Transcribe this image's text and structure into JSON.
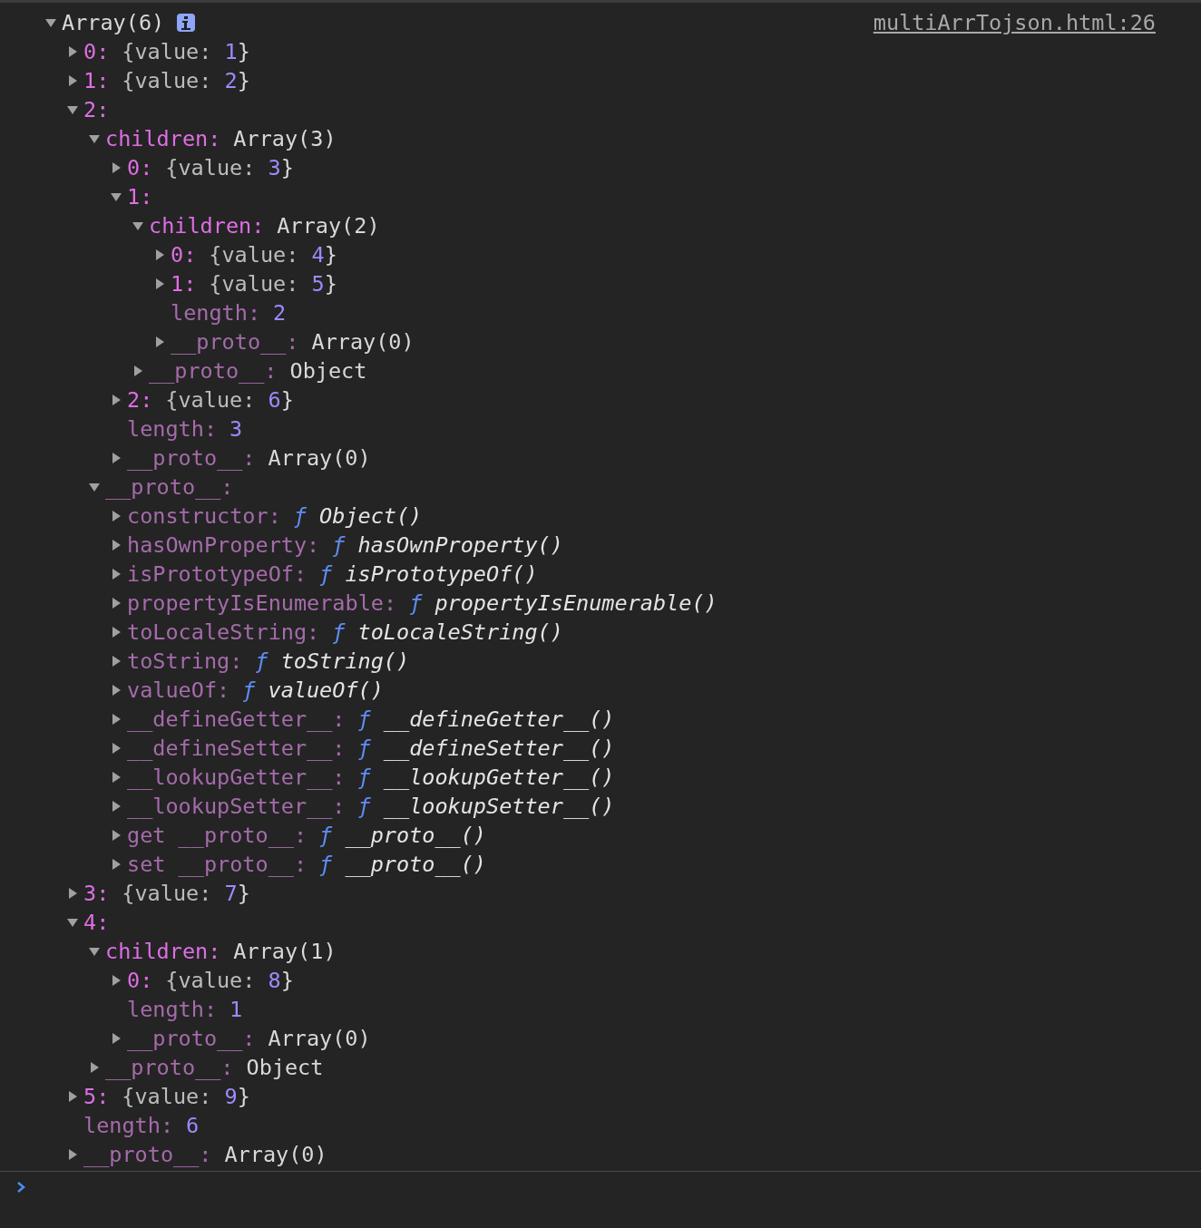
{
  "source": "multiArrTojson.html:26",
  "root": {
    "label": "Array(6)",
    "expanded": true,
    "children": [
      {
        "kind": "preview",
        "key": "0:",
        "own": true,
        "expanded": false,
        "preview": {
          "open": "{value:",
          "number": "1",
          "close": "}"
        }
      },
      {
        "kind": "preview",
        "key": "1:",
        "own": true,
        "expanded": false,
        "preview": {
          "open": "{value:",
          "number": "2",
          "close": "}"
        }
      },
      {
        "kind": "object",
        "key": "2:",
        "own": true,
        "expanded": true,
        "children": [
          {
            "kind": "object",
            "key": "children:",
            "own": true,
            "label": "Array(3)",
            "expanded": true,
            "children": [
              {
                "kind": "preview",
                "key": "0:",
                "own": true,
                "expanded": false,
                "preview": {
                  "open": "{value:",
                  "number": "3",
                  "close": "}"
                }
              },
              {
                "kind": "object",
                "key": "1:",
                "own": true,
                "expanded": true,
                "children": [
                  {
                    "kind": "object",
                    "key": "children:",
                    "own": true,
                    "label": "Array(2)",
                    "expanded": true,
                    "children": [
                      {
                        "kind": "preview",
                        "key": "0:",
                        "own": true,
                        "expanded": false,
                        "preview": {
                          "open": "{value:",
                          "number": "4",
                          "close": "}"
                        }
                      },
                      {
                        "kind": "preview",
                        "key": "1:",
                        "own": true,
                        "expanded": false,
                        "preview": {
                          "open": "{value:",
                          "number": "5",
                          "close": "}"
                        }
                      },
                      {
                        "kind": "number",
                        "key": "length:",
                        "own": false,
                        "value": "2"
                      },
                      {
                        "kind": "object",
                        "key": "__proto__:",
                        "own": false,
                        "label": "Array(0)",
                        "expanded": false
                      }
                    ]
                  },
                  {
                    "kind": "object",
                    "key": "__proto__:",
                    "own": false,
                    "label": "Object",
                    "expanded": false
                  }
                ]
              },
              {
                "kind": "preview",
                "key": "2:",
                "own": true,
                "expanded": false,
                "preview": {
                  "open": "{value:",
                  "number": "6",
                  "close": "}"
                }
              },
              {
                "kind": "number",
                "key": "length:",
                "own": false,
                "value": "3"
              },
              {
                "kind": "object",
                "key": "__proto__:",
                "own": false,
                "label": "Array(0)",
                "expanded": false
              }
            ]
          },
          {
            "kind": "object",
            "key": "__proto__:",
            "own": false,
            "expanded": true,
            "children": [
              {
                "kind": "function",
                "key": "constructor:",
                "own": false,
                "expanded": false,
                "mark": "ƒ",
                "name": "Object()"
              },
              {
                "kind": "function",
                "key": "hasOwnProperty:",
                "own": false,
                "expanded": false,
                "mark": "ƒ",
                "name": "hasOwnProperty()"
              },
              {
                "kind": "function",
                "key": "isPrototypeOf:",
                "own": false,
                "expanded": false,
                "mark": "ƒ",
                "name": "isPrototypeOf()"
              },
              {
                "kind": "function",
                "key": "propertyIsEnumerable:",
                "own": false,
                "expanded": false,
                "mark": "ƒ",
                "name": "propertyIsEnumerable()"
              },
              {
                "kind": "function",
                "key": "toLocaleString:",
                "own": false,
                "expanded": false,
                "mark": "ƒ",
                "name": "toLocaleString()"
              },
              {
                "kind": "function",
                "key": "toString:",
                "own": false,
                "expanded": false,
                "mark": "ƒ",
                "name": "toString()"
              },
              {
                "kind": "function",
                "key": "valueOf:",
                "own": false,
                "expanded": false,
                "mark": "ƒ",
                "name": "valueOf()"
              },
              {
                "kind": "function",
                "key": "__defineGetter__:",
                "own": false,
                "expanded": false,
                "mark": "ƒ",
                "name": "__defineGetter__()"
              },
              {
                "kind": "function",
                "key": "__defineSetter__:",
                "own": false,
                "expanded": false,
                "mark": "ƒ",
                "name": "__defineSetter__()"
              },
              {
                "kind": "function",
                "key": "__lookupGetter__:",
                "own": false,
                "expanded": false,
                "mark": "ƒ",
                "name": "__lookupGetter__()"
              },
              {
                "kind": "function",
                "key": "__lookupSetter__:",
                "own": false,
                "expanded": false,
                "mark": "ƒ",
                "name": "__lookupSetter__()"
              },
              {
                "kind": "function",
                "key": "get __proto__:",
                "own": false,
                "expanded": false,
                "mark": "ƒ",
                "name": "__proto__()"
              },
              {
                "kind": "function",
                "key": "set __proto__:",
                "own": false,
                "expanded": false,
                "mark": "ƒ",
                "name": "__proto__()"
              }
            ]
          }
        ]
      },
      {
        "kind": "preview",
        "key": "3:",
        "own": true,
        "expanded": false,
        "preview": {
          "open": "{value:",
          "number": "7",
          "close": "}"
        }
      },
      {
        "kind": "object",
        "key": "4:",
        "own": true,
        "expanded": true,
        "children": [
          {
            "kind": "object",
            "key": "children:",
            "own": true,
            "label": "Array(1)",
            "expanded": true,
            "children": [
              {
                "kind": "preview",
                "key": "0:",
                "own": true,
                "expanded": false,
                "preview": {
                  "open": "{value:",
                  "number": "8",
                  "close": "}"
                }
              },
              {
                "kind": "number",
                "key": "length:",
                "own": false,
                "value": "1"
              },
              {
                "kind": "object",
                "key": "__proto__:",
                "own": false,
                "label": "Array(0)",
                "expanded": false
              }
            ]
          },
          {
            "kind": "object",
            "key": "__proto__:",
            "own": false,
            "label": "Object",
            "expanded": false
          }
        ]
      },
      {
        "kind": "preview",
        "key": "5:",
        "own": true,
        "expanded": false,
        "preview": {
          "open": "{value:",
          "number": "9",
          "close": "}"
        }
      },
      {
        "kind": "number",
        "key": "length:",
        "own": false,
        "value": "6"
      },
      {
        "kind": "object",
        "key": "__proto__:",
        "own": false,
        "label": "Array(0)",
        "expanded": false
      }
    ]
  }
}
